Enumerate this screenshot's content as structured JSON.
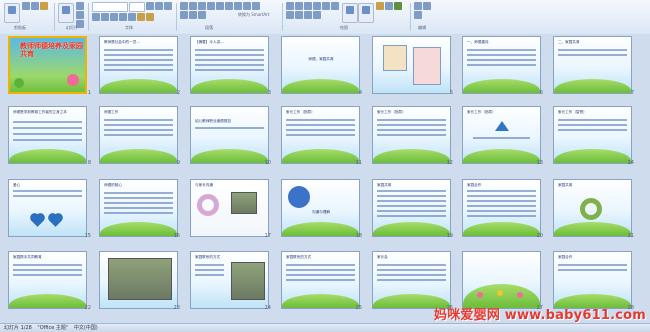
{
  "ribbon": {
    "groups": [
      "剪贴板",
      "幻灯片",
      "字体",
      "段落",
      "绘图",
      "编辑"
    ],
    "new_slide_label": "新建幻灯片",
    "arrange_label": "排列",
    "quick_styles_label": "快速样式",
    "find_label": "查找",
    "smartart_label": "转换为 SmartArt",
    "select_label": "选择"
  },
  "slides": [
    {
      "n": "1",
      "title": "教师师德培养及家园共育"
    },
    {
      "n": "2",
      "text": "教师是社会中的一员…"
    },
    {
      "n": "3",
      "text": "【摘要】众人讲…"
    },
    {
      "n": "4",
      "text": "师德、家园共育"
    },
    {
      "n": "5",
      "text": ""
    },
    {
      "n": "6",
      "text": "一、师德建设"
    },
    {
      "n": "7",
      "text": "二、家园共育"
    },
    {
      "n": "8",
      "text": "师德是学前教育工作者的立身之本"
    },
    {
      "n": "9",
      "text": "师德工作"
    },
    {
      "n": "10",
      "text": "幼儿教师职业道德规范"
    },
    {
      "n": "11",
      "text": "家长工作（指导）"
    },
    {
      "n": "12",
      "text": "家长工作（指导）"
    },
    {
      "n": "13",
      "text": "家长工作（指导）"
    },
    {
      "n": "14",
      "text": "家长工作（智慧）"
    },
    {
      "n": "15",
      "text": "爱心"
    },
    {
      "n": "16",
      "text": "师德的核心"
    },
    {
      "n": "17",
      "text": "与家长沟通"
    },
    {
      "n": "18",
      "text": "沟通与理解"
    },
    {
      "n": "19",
      "text": "家园共育"
    },
    {
      "n": "20",
      "text": "家园合作"
    },
    {
      "n": "21",
      "text": "家园共育"
    },
    {
      "n": "22",
      "text": "家园携手共同教育"
    },
    {
      "n": "23",
      "text": ""
    },
    {
      "n": "24",
      "text": "家园联系的方式"
    },
    {
      "n": "25",
      "text": "家园联系的方式"
    },
    {
      "n": "26",
      "text": "家长会"
    },
    {
      "n": "27",
      "text": ""
    },
    {
      "n": "28",
      "text": "家园合作"
    }
  ],
  "status": {
    "slide_info": "幻灯片 1/28",
    "theme": "\"Office 主题\"",
    "language": "中文(中国)"
  },
  "watermark": "妈咪爱婴网 www.baby611.com"
}
